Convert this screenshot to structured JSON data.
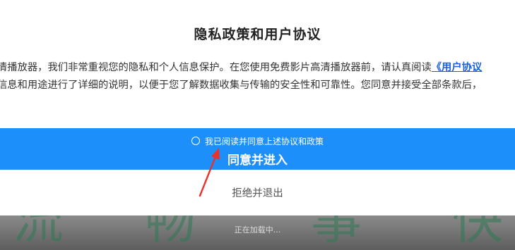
{
  "dialog": {
    "title": "隐私政策和用户协议",
    "line1_text": "清播放器，我们非常重视您的隐私和个人信息保护。在您使用免费影片高清播放器前，请认真阅读",
    "line1_link": "《用户协议",
    "line2_text": "信息和用途进行了详细的说明，以便于您了解数据收集与传输的安全性和可靠性。您同意并接受全部条款后，",
    "consent_label": "我已阅读并同意上述协议和政策",
    "accept_label": "同意并进入",
    "decline_label": "拒绝并退出"
  },
  "splash": {
    "brand_chars": [
      "流",
      "畅",
      "事",
      "快"
    ],
    "loading_text": "正在加载中..."
  },
  "colors": {
    "accent": "#1d8ffa",
    "link": "#1a5fe0",
    "annotation_arrow": "#e8332a"
  }
}
